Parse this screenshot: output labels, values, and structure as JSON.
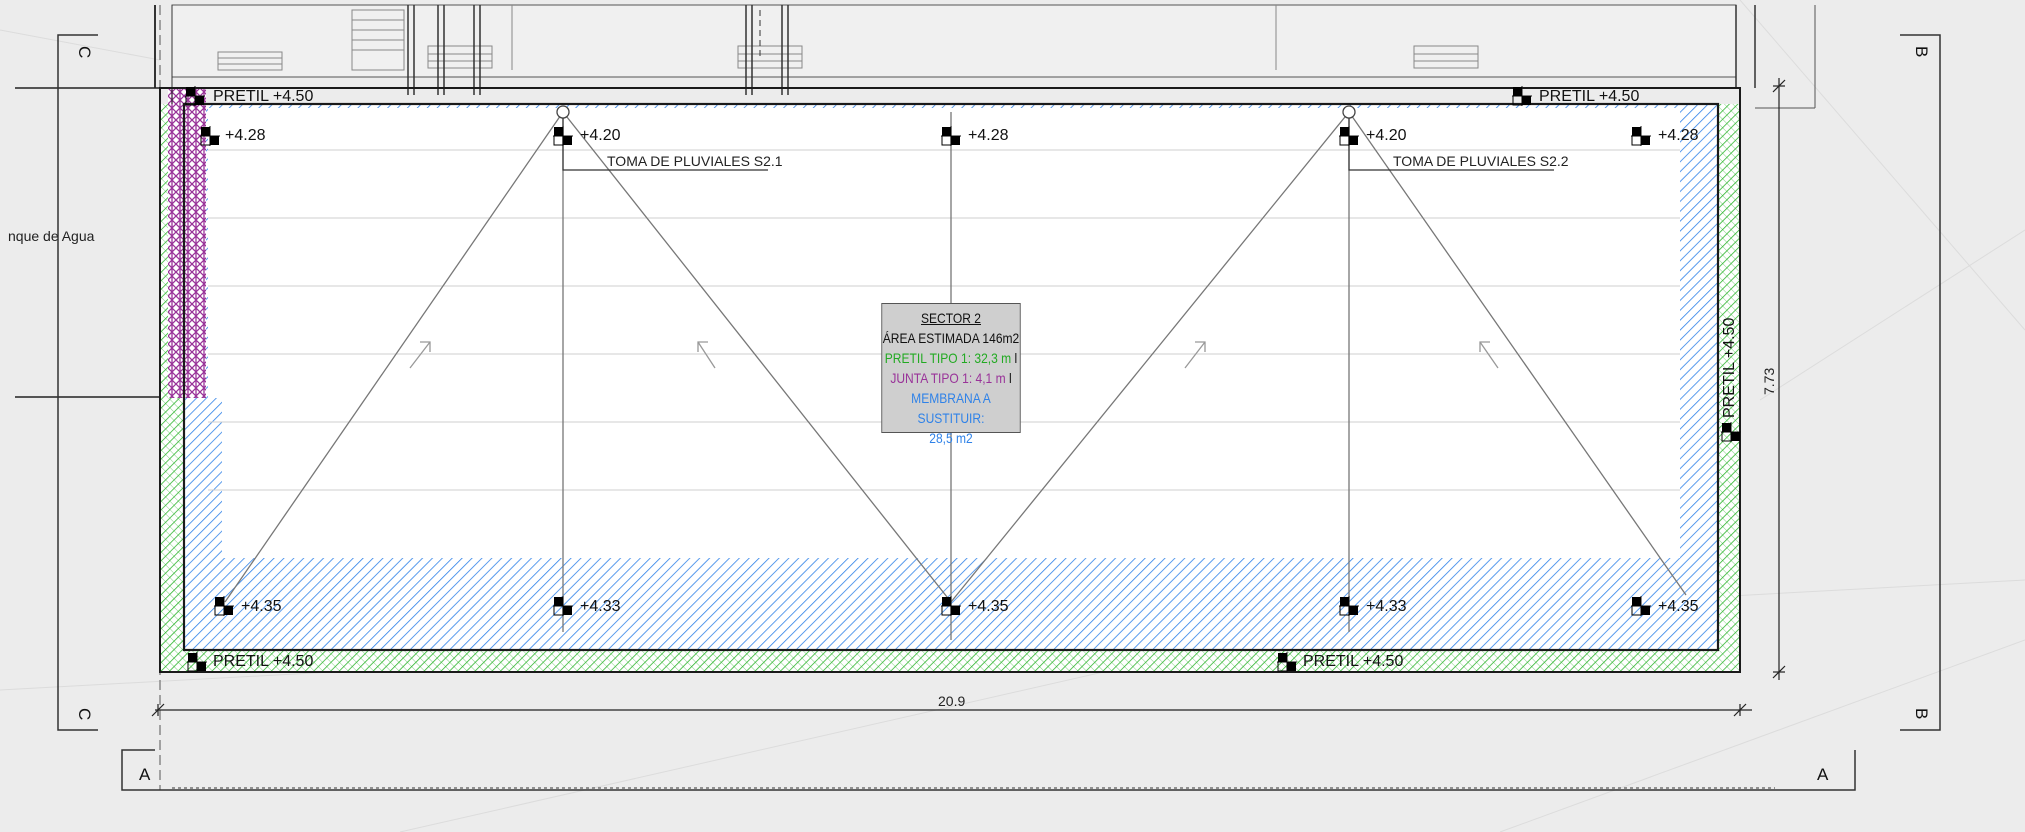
{
  "sector": {
    "title": "SECTOR 2",
    "area": "ÁREA ESTIMADA 146m2",
    "pretil": "PRETIL TIPO 1: 32,3 m",
    "junta": "JUNTA TIPO 1: 4,1 m",
    "membrana_line1": "MEMBRANA A SUSTITUIR:",
    "membrana_line2": "28,5 m2",
    "bar": "l"
  },
  "labels": {
    "tanque": "nque de Agua",
    "pretil_top_left": "PRETIL +4.50",
    "pretil_top_right": "PRETIL +4.50",
    "pretil_bottom_left": "PRETIL +4.50",
    "pretil_bottom_mid": "PRETIL +4.50",
    "pretil_right": "PRETIL +4.50",
    "toma1": "TOMA DE PLUVIALES  S2.1",
    "toma2": "TOMA DE PLUVIALES  S2.2",
    "dim_width": "20.9",
    "dim_height": "7.73"
  },
  "levels": {
    "top": [
      "+4.28",
      "+4.20",
      "+4.28",
      "+4.20",
      "+4.28"
    ],
    "bottom": [
      "+4.35",
      "+4.33",
      "+4.35",
      "+4.33",
      "+4.35"
    ]
  },
  "section_marks": {
    "c": "C",
    "b": "B",
    "a": "A"
  },
  "colors": {
    "pretil": "#2fb52f",
    "junta": "#993399",
    "membrana": "#2f82e8",
    "line": "#1a1a1a",
    "background": "#ececec"
  }
}
